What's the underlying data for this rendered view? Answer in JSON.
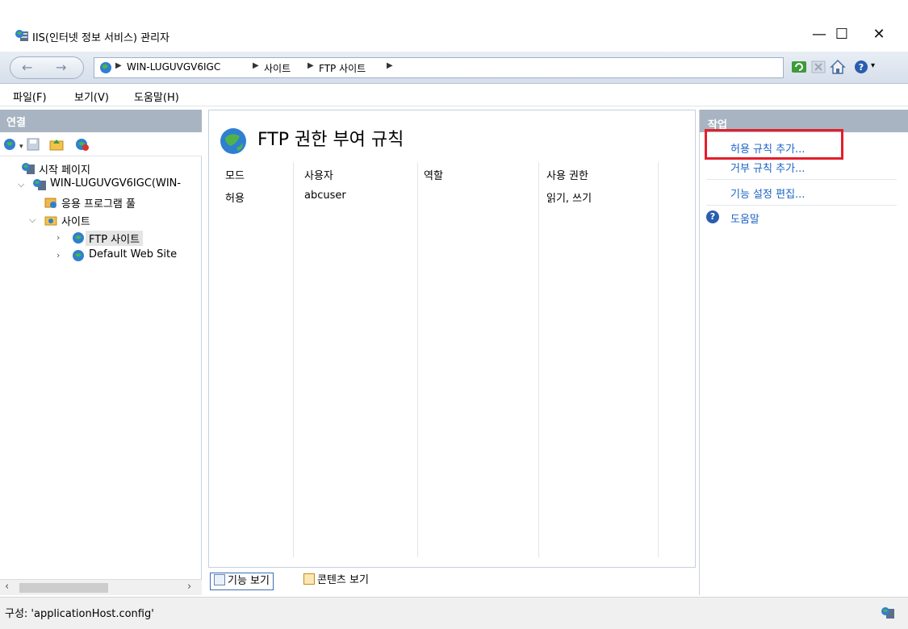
{
  "window": {
    "title": "IIS(인터넷 정보 서비스) 관리자",
    "controls": {
      "minimize": "—",
      "maximize": "☐",
      "close": "✕"
    }
  },
  "address": {
    "back": "←",
    "forward": "→",
    "breadcrumbs": [
      "WIN-LUGUVGV6IGC",
      "사이트",
      "FTP 사이트"
    ],
    "separator": "▶"
  },
  "menu": {
    "items": [
      "파일(F)",
      "보기(V)",
      "도움말(H)"
    ]
  },
  "connections": {
    "header": "연결",
    "tree": [
      {
        "label": "시작 페이지",
        "icon": "start-page-icon"
      },
      {
        "label": "WIN-LUGUVGV6IGC(WIN-",
        "icon": "server-icon"
      },
      {
        "label": "응용 프로그램 풀",
        "icon": "app-pool-icon"
      },
      {
        "label": "사이트",
        "icon": "sites-folder-icon"
      },
      {
        "label": "FTP 사이트",
        "icon": "globe-icon",
        "selected": true
      },
      {
        "label": "Default Web Site",
        "icon": "globe-icon"
      }
    ]
  },
  "feature": {
    "title": "FTP 권한 부여 규칙",
    "columns": [
      "모드",
      "사용자",
      "역할",
      "사용 권한"
    ],
    "rows": [
      {
        "mode": "허용",
        "user": "abcuser",
        "role": "",
        "permissions": "읽기, 쓰기"
      }
    ],
    "tabs": {
      "feature_view": "기능 보기",
      "content_view": "콘텐츠 보기"
    }
  },
  "actions": {
    "header": "작업",
    "items": [
      "허용 규칙 추가...",
      "거부 규칙 추가...",
      "기능 설정 편집..."
    ],
    "help": "도움말",
    "help_icon": "?",
    "highlight_color": "#e41e2a",
    "link_color": "#1b63c6"
  },
  "status": {
    "text": "구성: 'applicationHost.config'"
  }
}
